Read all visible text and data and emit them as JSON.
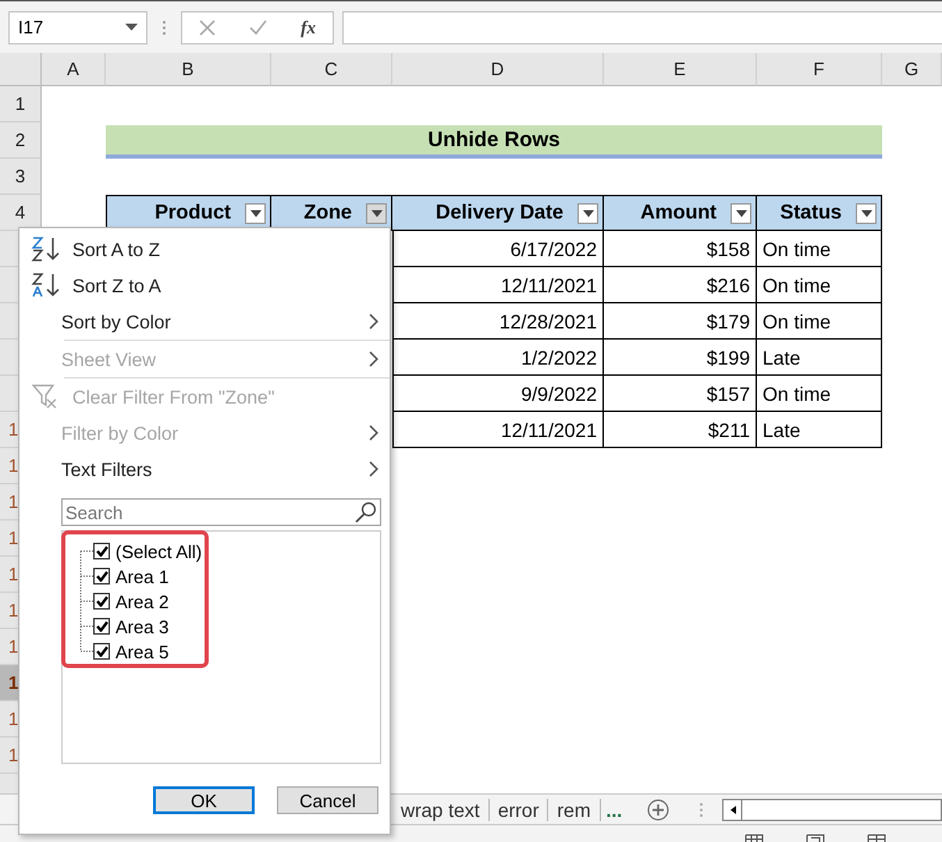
{
  "name_box": "I17",
  "formula_bar": {
    "fx_label": "fx"
  },
  "columns": [
    {
      "label": "A"
    },
    {
      "label": "B"
    },
    {
      "label": "C"
    },
    {
      "label": "D"
    },
    {
      "label": "E"
    },
    {
      "label": "F"
    },
    {
      "label": "G"
    }
  ],
  "rows": [
    {
      "label": "1",
      "selected": false
    },
    {
      "label": "2",
      "selected": false
    },
    {
      "label": "3",
      "selected": false
    },
    {
      "label": "4",
      "selected": false
    },
    {
      "selected": false
    },
    {
      "selected": false
    },
    {
      "selected": false
    },
    {
      "selected": false
    },
    {
      "selected": false
    },
    {
      "label": "1",
      "selected": false
    },
    {
      "label": "1",
      "selected": false
    },
    {
      "label": "1",
      "selected": false
    },
    {
      "label": "1",
      "selected": false
    },
    {
      "label": "1",
      "selected": false
    },
    {
      "label": "1",
      "selected": false
    },
    {
      "label": "1",
      "selected": false
    },
    {
      "label": "1",
      "selected": true
    },
    {
      "label": "1",
      "selected": false
    },
    {
      "label": "1",
      "selected": false
    }
  ],
  "title": "Unhide Rows",
  "table": {
    "columns": [
      {
        "label": "Product",
        "filter_active": false
      },
      {
        "label": "Zone",
        "filter_active": true
      },
      {
        "label": "Delivery Date",
        "filter_active": false
      },
      {
        "label": "Amount",
        "filter_active": false
      },
      {
        "label": "Status",
        "filter_active": false
      }
    ],
    "rows": [
      {
        "delivery_date": "6/17/2022",
        "amount": "$158",
        "status": "On time"
      },
      {
        "delivery_date": "12/11/2021",
        "amount": "$216",
        "status": "On time"
      },
      {
        "delivery_date": "12/28/2021",
        "amount": "$179",
        "status": "On time"
      },
      {
        "delivery_date": "1/2/2022",
        "amount": "$199",
        "status": "Late"
      },
      {
        "delivery_date": "9/9/2022",
        "amount": "$157",
        "status": "On time"
      },
      {
        "delivery_date": "12/11/2021",
        "amount": "$211",
        "status": "Late"
      }
    ]
  },
  "filter_menu": {
    "items": [
      {
        "kind": "sort_az",
        "label": "Sort A to Z",
        "disabled": false,
        "submenu": false
      },
      {
        "kind": "sort_za",
        "label": "Sort Z to A",
        "disabled": false,
        "submenu": false
      },
      {
        "kind": "plain",
        "label": "Sort by Color",
        "disabled": false,
        "submenu": true
      },
      {
        "kind": "separator"
      },
      {
        "kind": "plain",
        "label": "Sheet View",
        "disabled": true,
        "submenu": true
      },
      {
        "kind": "separator"
      },
      {
        "kind": "clear_filter",
        "label": "Clear Filter From \"Zone\"",
        "disabled": true,
        "submenu": false
      },
      {
        "kind": "plain",
        "label": "Filter by Color",
        "disabled": true,
        "submenu": true
      },
      {
        "kind": "plain",
        "label": "Text Filters",
        "disabled": false,
        "submenu": true
      }
    ],
    "search": {
      "placeholder": "Search"
    },
    "values": [
      {
        "label": "(Select All)",
        "checked": true
      },
      {
        "label": "Area 1",
        "checked": true
      },
      {
        "label": "Area 2",
        "checked": true
      },
      {
        "label": "Area 3",
        "checked": true
      },
      {
        "label": "Area 5",
        "checked": true
      }
    ],
    "buttons": [
      {
        "label": "OK",
        "focused": true
      },
      {
        "label": "Cancel",
        "focused": false
      }
    ]
  },
  "sheet_tabs": [
    {
      "label": "wrap text"
    },
    {
      "label": "error"
    },
    {
      "label": "rem"
    }
  ],
  "more_tabs": "..."
}
